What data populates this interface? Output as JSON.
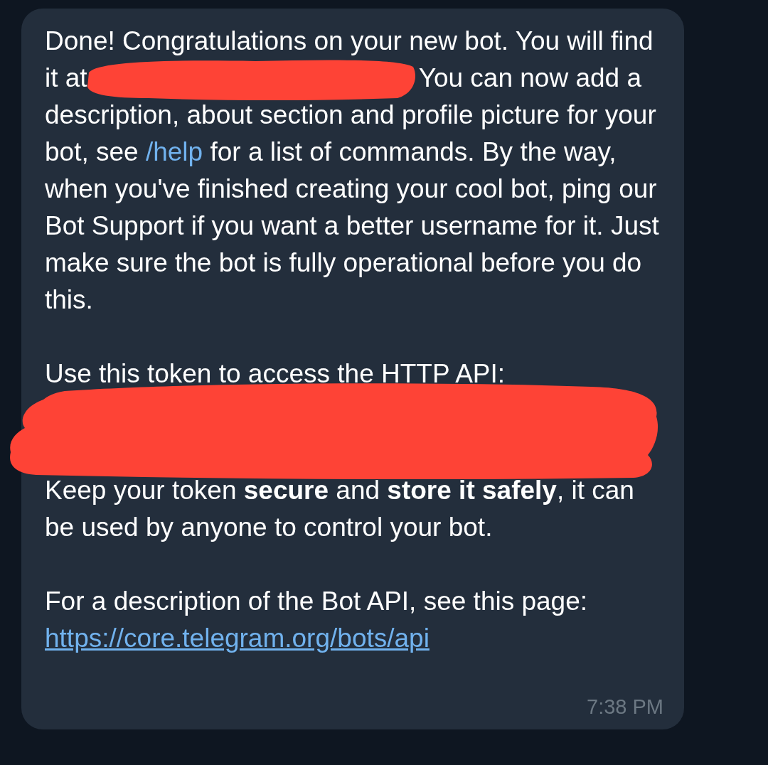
{
  "message": {
    "paragraphs": [
      {
        "segments": [
          {
            "kind": "text",
            "text": "Done! Congratulations on your new bot. You will find it at"
          },
          {
            "kind": "redaction"
          },
          {
            "kind": "text",
            "text": "You can now add a description, about section and profile picture for your bot, see "
          },
          {
            "kind": "link",
            "text": "/help"
          },
          {
            "kind": "text",
            "text": " for a list of commands. By the way, when you've finished creating your cool bot, ping our Bot Support if you want a better username for it. Just make sure the bot is fully operational before you do this."
          }
        ]
      },
      {
        "segments": [
          {
            "kind": "text",
            "text": "Use this token to access the HTTP API:"
          },
          {
            "kind": "redaction_block"
          },
          {
            "kind": "text",
            "text": "Keep your token **secure** and **store it safely**, it can be used by anyone to control your bot."
          }
        ]
      },
      {
        "segments": [
          {
            "kind": "text",
            "text": "For a description of the Bot API, see this page: "
          },
          {
            "kind": "link",
            "text": "https://core.telegram.org/bots/api"
          }
        ]
      }
    ],
    "time": "7:38 PM"
  }
}
